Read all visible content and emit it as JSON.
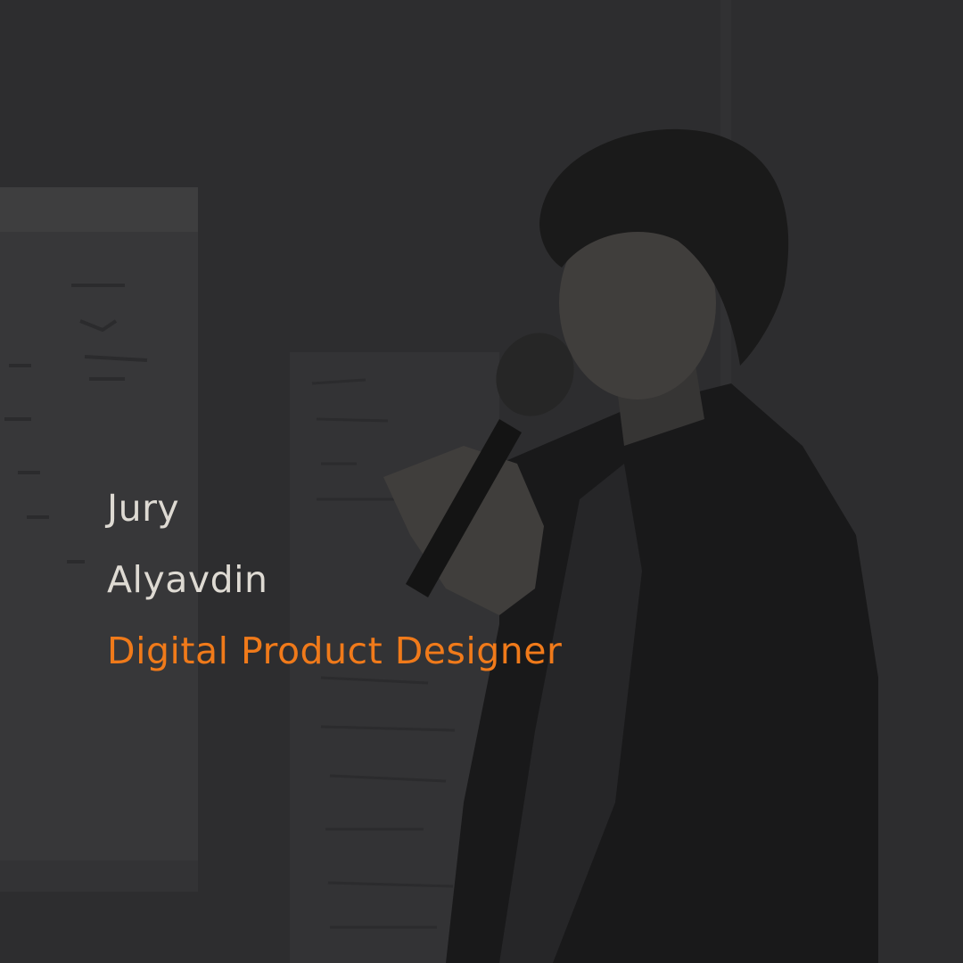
{
  "profile": {
    "first_name": "Jury",
    "last_name": "Alyavdin",
    "title": "Digital Product Designer"
  },
  "colors": {
    "background": "#2f2f31",
    "name_text": "#dedad3",
    "accent": "#f07a1a"
  },
  "photo": {
    "subject": "speaker-holding-microphone"
  }
}
